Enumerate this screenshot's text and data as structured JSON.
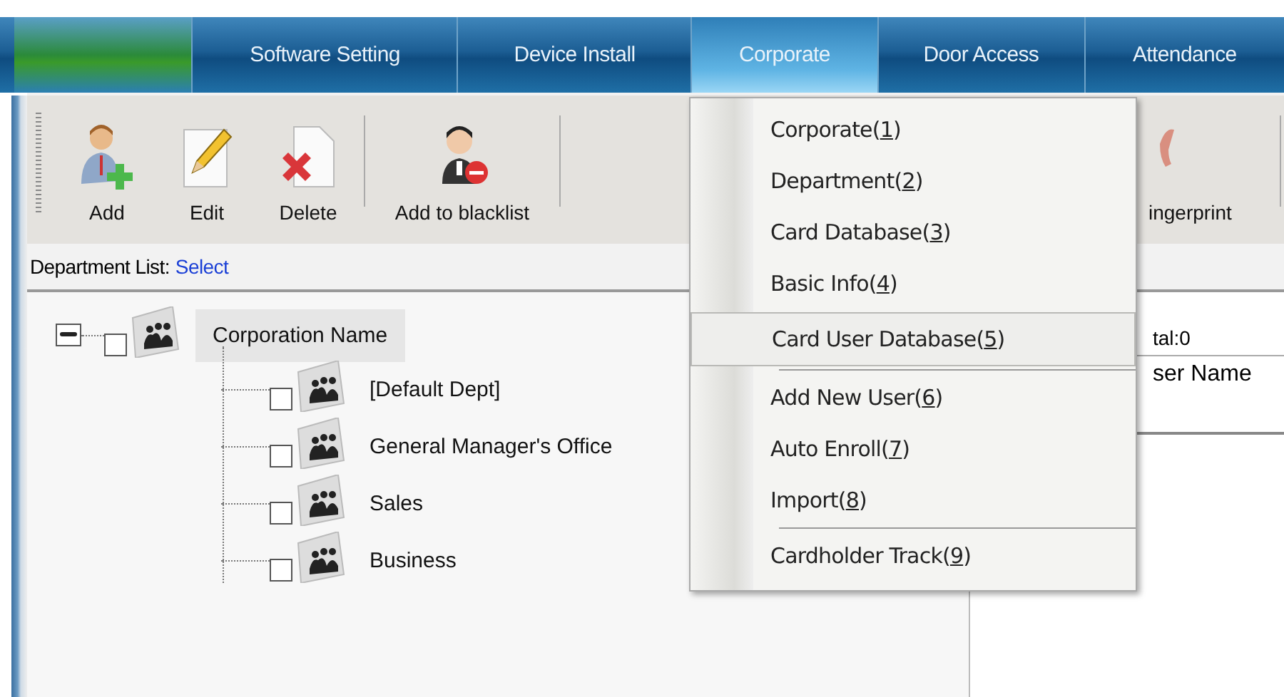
{
  "nav_tabs": [
    {
      "label": "Software Setting",
      "selected": false
    },
    {
      "label": "Device Install",
      "selected": false
    },
    {
      "label": "Corporate",
      "selected": true
    },
    {
      "label": "Door Access",
      "selected": false
    },
    {
      "label": "Attendance",
      "selected": false
    }
  ],
  "toolbar": [
    {
      "label": "Add",
      "kind": "add"
    },
    {
      "label": "Edit",
      "kind": "edit"
    },
    {
      "label": "Delete",
      "kind": "delete"
    },
    {
      "label": "Add to blacklist",
      "kind": "blacklist"
    },
    {
      "label": "ingerprint",
      "kind": "fingerprint"
    }
  ],
  "department_list": {
    "label": "Department List:",
    "link": "Select"
  },
  "tree": {
    "label": "Corporation Name",
    "expanded": true,
    "checked": false,
    "children": [
      {
        "label": "[Default Dept]",
        "checked": false
      },
      {
        "label": "General Manager's Office",
        "checked": false
      },
      {
        "label": "Sales",
        "checked": false
      },
      {
        "label": "Business",
        "checked": false
      }
    ]
  },
  "user_panel": {
    "total": "tal:0",
    "column_1": "ser Name"
  },
  "menu": [
    {
      "before": "Corporate(",
      "mnemonic": "1",
      "after": ")",
      "selected": false,
      "separator_after": false
    },
    {
      "before": "Department(",
      "mnemonic": "2",
      "after": ")",
      "selected": false,
      "separator_after": false
    },
    {
      "before": "Card Database(",
      "mnemonic": "3",
      "after": ")",
      "selected": false,
      "separator_after": false
    },
    {
      "before": "Basic Info(",
      "mnemonic": "4",
      "after": ")",
      "selected": false,
      "separator_after": false
    },
    {
      "before": "Card User Database(",
      "mnemonic": "5",
      "after": ")",
      "selected": true,
      "separator_after": true
    },
    {
      "before": "Add New User(",
      "mnemonic": "6",
      "after": ")",
      "selected": false,
      "separator_after": false
    },
    {
      "before": "Auto Enroll(",
      "mnemonic": "7",
      "after": ")",
      "selected": false,
      "separator_after": false
    },
    {
      "before": "Import(",
      "mnemonic": "8",
      "after": ")",
      "selected": false,
      "separator_after": true
    },
    {
      "before": "Cardholder Track(",
      "mnemonic": "9",
      "after": ")",
      "selected": false,
      "separator_after": false
    }
  ]
}
